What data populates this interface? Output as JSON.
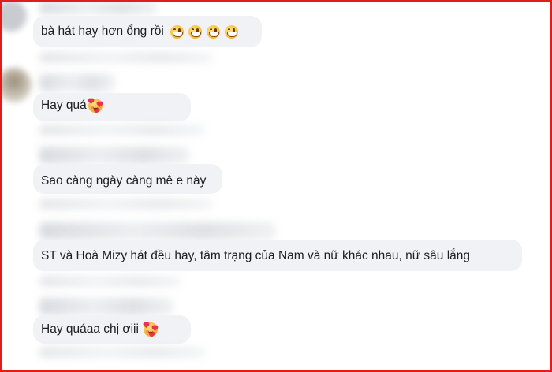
{
  "comments": [
    {
      "text": "bà hát hay hơn ổng rồi",
      "emoji": [
        "beaming-face-icon",
        "beaming-face-icon",
        "beaming-face-icon",
        "beaming-face-icon"
      ]
    },
    {
      "text": "Hay quá",
      "emoji": [
        "smiling-face-with-hearts-icon"
      ]
    },
    {
      "text": "Sao càng ngày càng mê e này",
      "emoji": []
    },
    {
      "text": "ST và Hoà Mizy hát đều hay, tâm trạng của Nam và nữ khác nhau, nữ sâu lắng",
      "emoji": []
    },
    {
      "text": "Hay quáaa chị ơiii",
      "emoji": [
        "smiling-face-with-hearts-icon"
      ]
    }
  ],
  "colors": {
    "border": "#e21b1b",
    "bubble": "#f0f2f5",
    "text": "#1c1e21"
  }
}
